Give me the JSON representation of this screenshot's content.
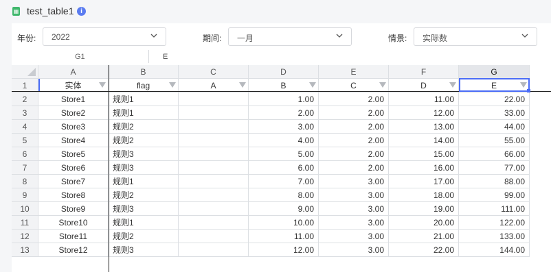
{
  "header": {
    "title": "test_table1",
    "info_icon": "i"
  },
  "filters": {
    "year": {
      "label": "年份:",
      "value": "2022"
    },
    "period": {
      "label": "期间:",
      "value": "一月"
    },
    "scenario": {
      "label": "情景:",
      "value": "实际数"
    }
  },
  "formula_bar": {
    "cell_ref": "G1",
    "content": "E"
  },
  "grid": {
    "col_letters": [
      "A",
      "B",
      "C",
      "D",
      "E",
      "F",
      "G"
    ],
    "header_row": [
      "实体",
      "flag",
      "A",
      "B",
      "C",
      "D",
      "E"
    ],
    "row_numbers": [
      "1",
      "2",
      "3",
      "4",
      "5",
      "6",
      "7",
      "8",
      "9",
      "10",
      "11",
      "12",
      "13"
    ],
    "rows": [
      [
        "Store1",
        "规则1",
        "",
        "1.00",
        "2.00",
        "11.00",
        "22.00"
      ],
      [
        "Store2",
        "规则1",
        "",
        "2.00",
        "2.00",
        "12.00",
        "33.00"
      ],
      [
        "Store3",
        "规则2",
        "",
        "3.00",
        "2.00",
        "13.00",
        "44.00"
      ],
      [
        "Store4",
        "规则2",
        "",
        "4.00",
        "2.00",
        "14.00",
        "55.00"
      ],
      [
        "Store5",
        "规则3",
        "",
        "5.00",
        "2.00",
        "15.00",
        "66.00"
      ],
      [
        "Store6",
        "规则3",
        "",
        "6.00",
        "2.00",
        "16.00",
        "77.00"
      ],
      [
        "Store7",
        "规则1",
        "",
        "7.00",
        "3.00",
        "17.00",
        "88.00"
      ],
      [
        "Store8",
        "规则2",
        "",
        "8.00",
        "3.00",
        "18.00",
        "99.00"
      ],
      [
        "Store9",
        "规则3",
        "",
        "9.00",
        "3.00",
        "19.00",
        "111.00"
      ],
      [
        "Store10",
        "规则1",
        "",
        "10.00",
        "3.00",
        "20.00",
        "122.00"
      ],
      [
        "Store11",
        "规则2",
        "",
        "11.00",
        "3.00",
        "21.00",
        "133.00"
      ],
      [
        "Store12",
        "规则3",
        "",
        "12.00",
        "3.00",
        "22.00",
        "144.00"
      ]
    ],
    "selected_col": "G"
  }
}
